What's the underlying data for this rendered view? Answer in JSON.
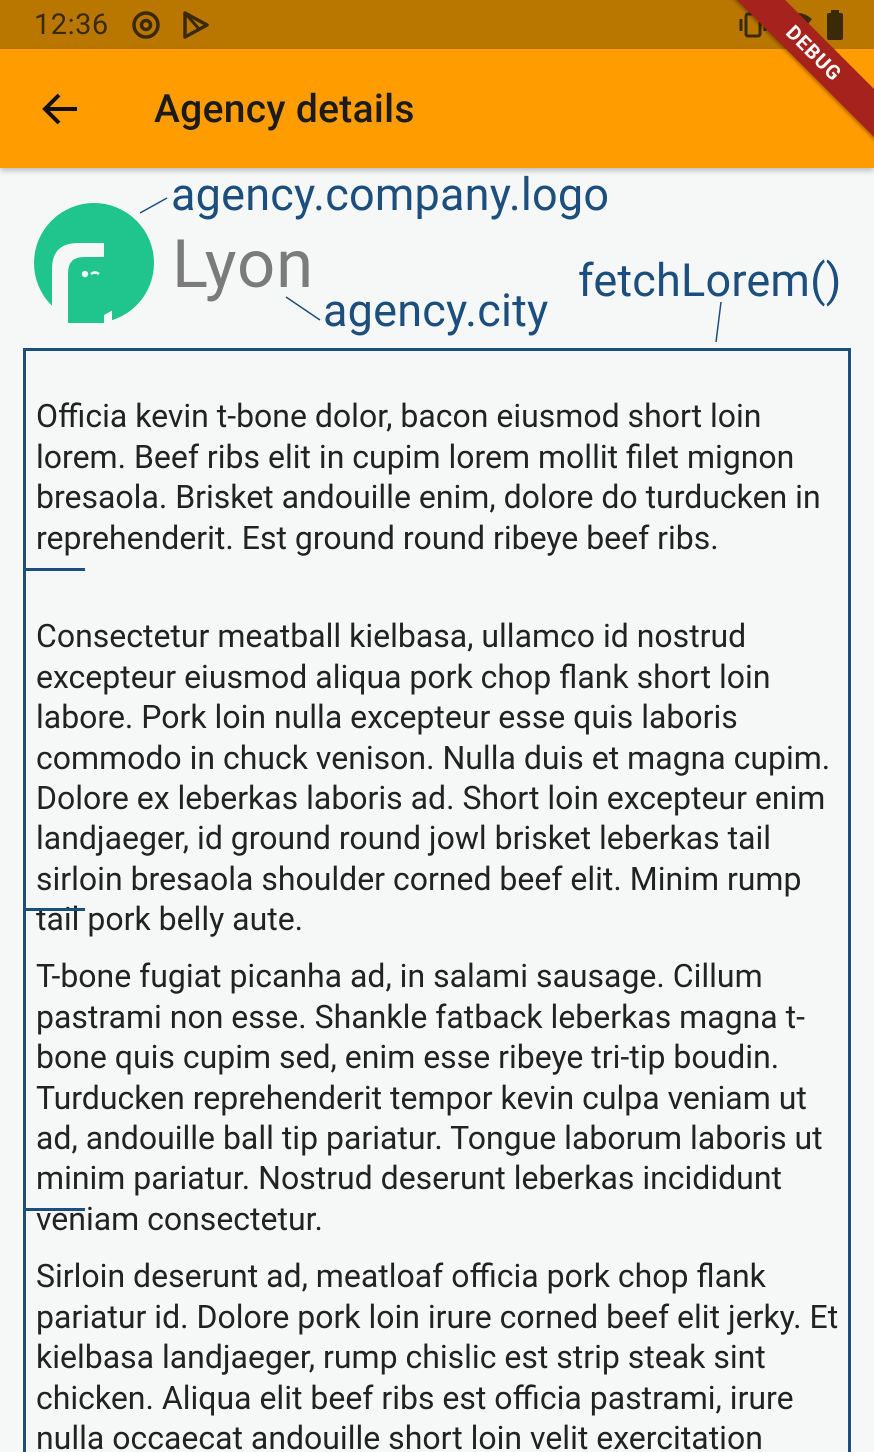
{
  "status_bar": {
    "time": "12:36",
    "icons": [
      "at-sign-icon",
      "play-store-icon",
      "vibrate-icon",
      "wifi-icon",
      "battery-icon"
    ]
  },
  "app_bar": {
    "title": "Agency details",
    "back_icon": "arrow-back-icon",
    "background": "#ff9c00"
  },
  "debug_banner": {
    "label": "DEBUG"
  },
  "header": {
    "logo_wordmark": "Lyon",
    "annotations": {
      "logo": "agency.company.logo",
      "city": "agency.city",
      "fetch": "fetchLorem()"
    }
  },
  "paragraphs": [
    "Officia kevin t-bone dolor, bacon eiusmod short loin lorem.  Beef ribs elit in cupim lorem mollit filet mignon bresaola.  Brisket andouille enim, dolore do turducken in reprehenderit.  Est ground round ribeye beef ribs.",
    "Consectetur meatball kielbasa, ullamco id nostrud excepteur eiusmod aliqua pork chop flank short loin labore.  Pork loin nulla excepteur esse quis laboris commodo in chuck venison.  Nulla duis et magna cupim.  Dolore ex leberkas laboris ad.  Short loin excepteur enim landjaeger, id ground round jowl brisket leberkas tail sirloin bresaola shoulder corned beef elit.  Minim rump tail pork belly aute.",
    "T-bone fugiat picanha ad, in salami sausage.  Cillum pastrami non esse.  Shankle fatback leberkas magna t-bone quis cupim sed, enim esse ribeye tri-tip boudin.  Turducken reprehenderit tempor kevin culpa veniam ut ad, andouille ball tip pariatur.  Tongue laborum laboris ut minim pariatur.  Nostrud deserunt leberkas incididunt veniam consectetur.",
    "Sirloin deserunt ad, meatloaf officia pork chop flank pariatur id.  Dolore pork loin irure corned beef elit jerky.  Et kielbasa landjaeger, rump chislic est strip steak sint chicken.  Aliqua elit beef ribs est officia pastrami, irure nulla occaecat andouille short loin velit exercitation prosciutto leberkas.  Brisket qui sint"
  ],
  "colors": {
    "accent": "#ff9c00",
    "annotation": "#1c4e7e",
    "logo_green": "#1fc58d"
  }
}
